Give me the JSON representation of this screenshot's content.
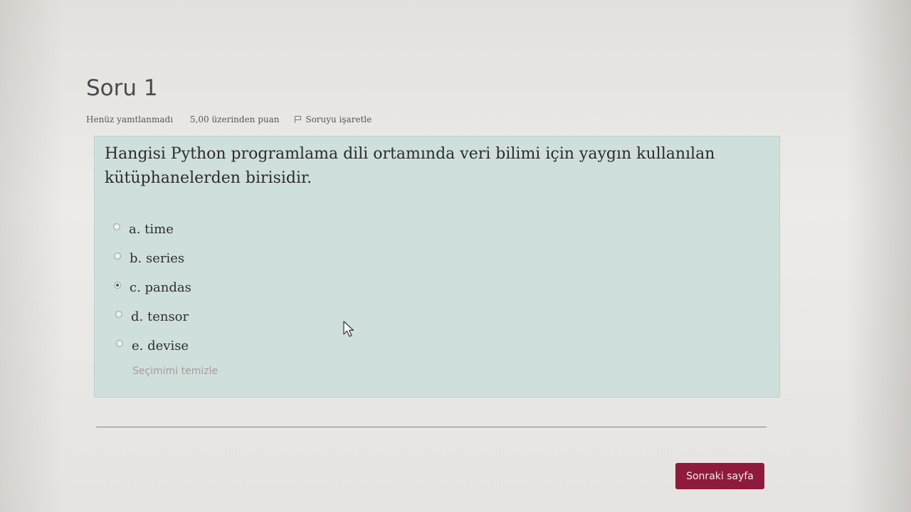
{
  "question": {
    "number_label": "Soru 1",
    "status": "Henüz yamtlanmadı",
    "points": "5,00 üzerinden puan",
    "flag_label": "Soruyu işaretle",
    "text": "Hangisi Python programlama dili ortamında veri bilimi için yaygın kullanılan kütüphanelerden birisidir.",
    "answers": [
      {
        "label": "a. time",
        "selected": false
      },
      {
        "label": "b. series",
        "selected": false
      },
      {
        "label": "c. pandas",
        "selected": true
      },
      {
        "label": "d. tensor",
        "selected": false
      },
      {
        "label": "e. devise",
        "selected": false
      }
    ],
    "clear_label": "Seçimimi temizle"
  },
  "navigation": {
    "next_label": "Sonraki sayfa"
  },
  "colors": {
    "question_bg": "#cfdfdc",
    "button_bg": "#8e1b3b",
    "link": "#a99a9c"
  },
  "icons": {
    "flag": "flag-icon",
    "cursor": "mouse-pointer-icon"
  }
}
